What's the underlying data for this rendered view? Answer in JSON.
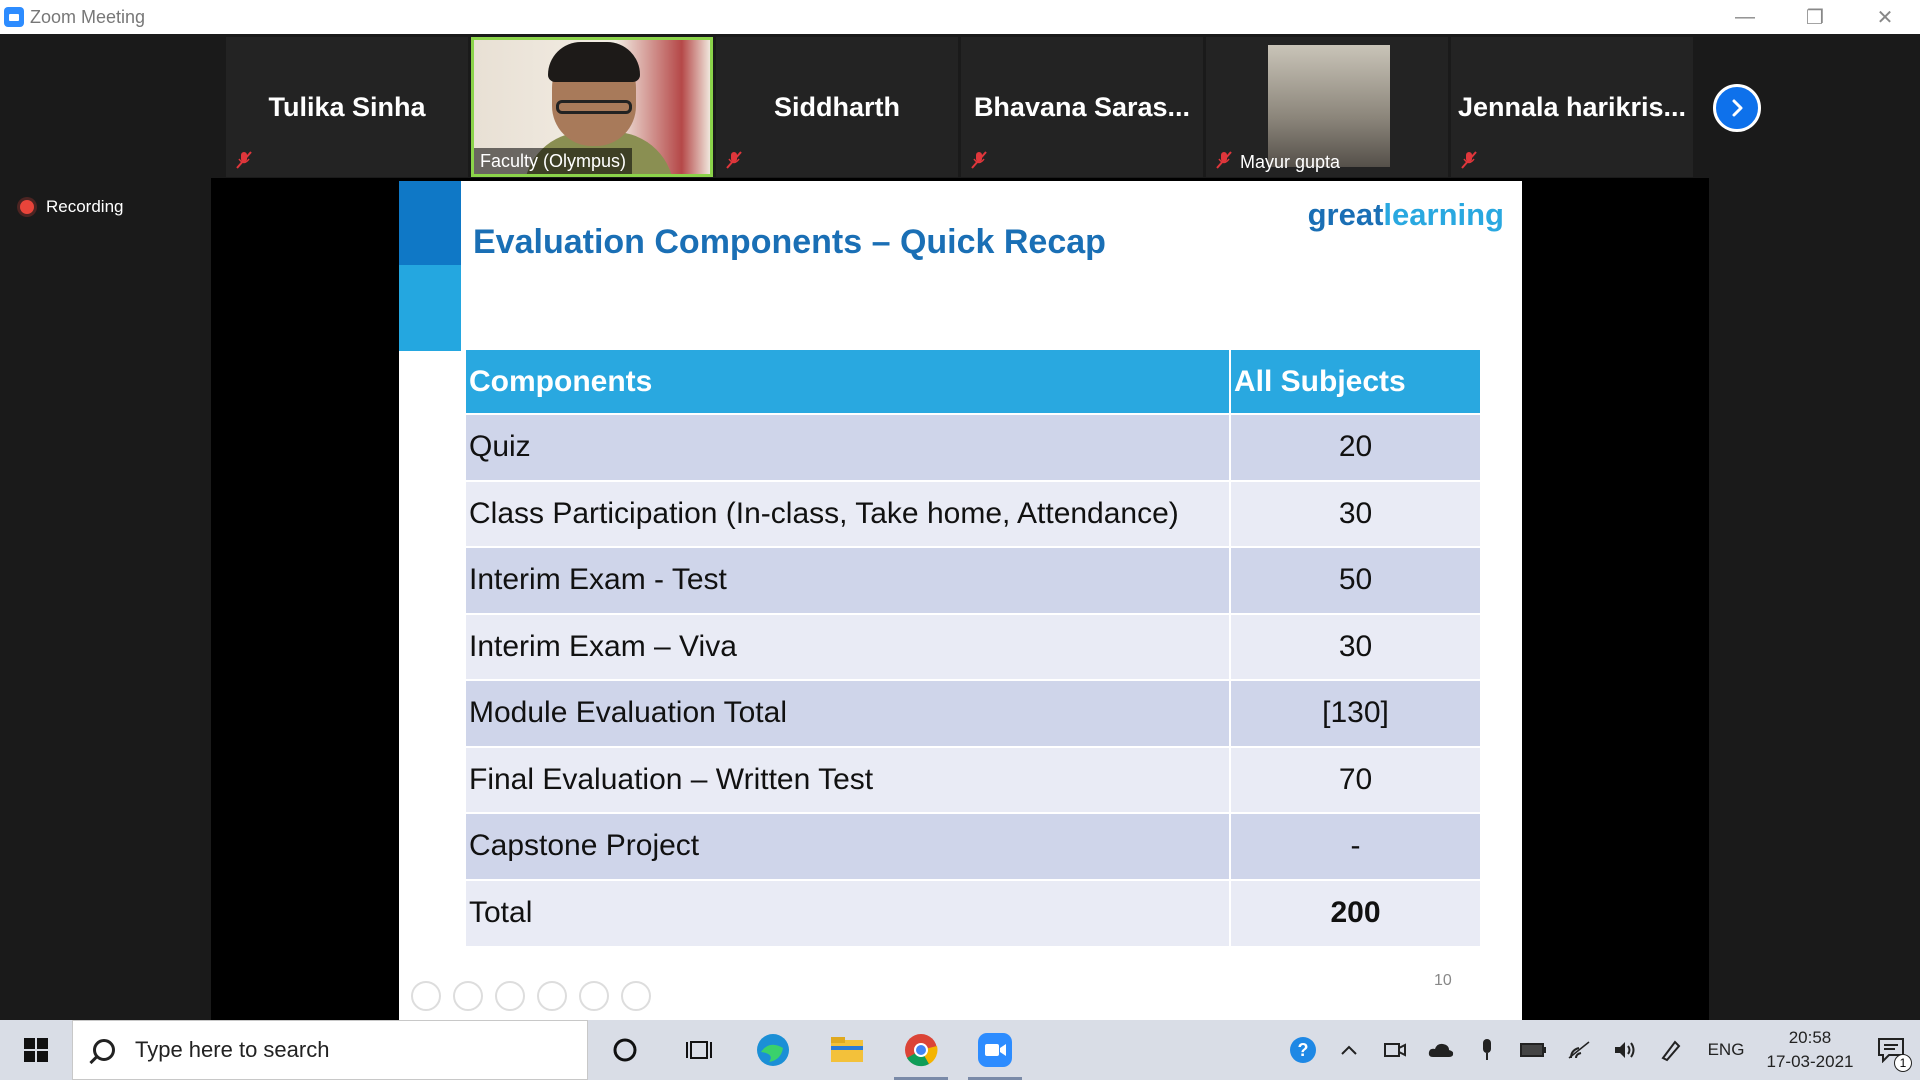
{
  "window": {
    "title": "Zoom Meeting"
  },
  "gallery": {
    "participants": [
      {
        "name": "Tulika Sinha",
        "video": false
      },
      {
        "name": "Faculty (Olympus)",
        "video": true
      },
      {
        "name": "Siddharth",
        "video": false
      },
      {
        "name": "Bhavana  Saras...",
        "video": false
      },
      {
        "name": "Mayur gupta",
        "video": true
      },
      {
        "name": "Jennala  harikris...",
        "video": false
      }
    ]
  },
  "recording": {
    "label": "Recording"
  },
  "slide": {
    "title": "Evaluation Components – Quick Recap",
    "brand_part1": "great",
    "brand_part2": "learning",
    "table": {
      "headers": [
        "Components",
        "All Subjects"
      ],
      "rows": [
        {
          "component": "Quiz",
          "value": "20"
        },
        {
          "component": "Class Participation (In-class, Take home, Attendance)",
          "value": "30"
        },
        {
          "component": "Interim Exam - Test",
          "value": "50"
        },
        {
          "component": "Interim Exam – Viva",
          "value": "30"
        },
        {
          "component": "Module Evaluation Total",
          "value": "[130]"
        },
        {
          "component": "Final Evaluation – Written Test",
          "value": "70"
        },
        {
          "component": "Capstone Project",
          "value": "-"
        },
        {
          "component": "Total",
          "value": "200"
        }
      ]
    },
    "page_number": "10"
  },
  "taskbar": {
    "search_placeholder": "Type here to search",
    "language": "ENG",
    "time": "20:58",
    "date": "17-03-2021",
    "notification_count": "1"
  },
  "colors": {
    "accent_blue": "#29a8e0",
    "title_blue": "#1a6fb5",
    "row_odd": "#cfd5ea",
    "row_even": "#e9ebf5",
    "zoom_blue": "#0e71eb",
    "recording_red": "#e8443a"
  }
}
